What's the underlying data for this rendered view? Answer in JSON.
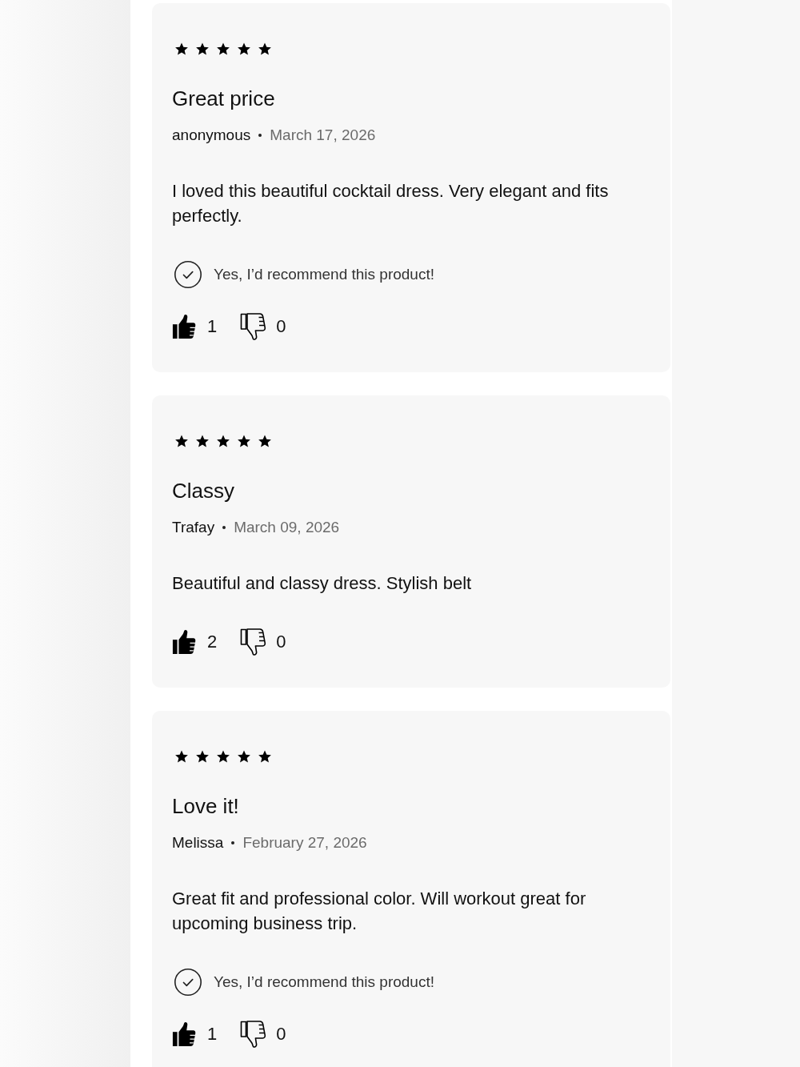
{
  "reviews": [
    {
      "stars": 5,
      "title": "Great price",
      "author": "anonymous",
      "date": "March 17, 2026",
      "body": "I loved this beautiful cocktail dress. Very elegant and fits perfectly.",
      "recommendation": "Yes, I’d recommend this product!",
      "helpful_count": "1",
      "unhelpful_count": "0"
    },
    {
      "stars": 5,
      "title": "Classy",
      "author": "Trafay",
      "date": "March 09, 2026",
      "body": "Beautiful and classy dress. Stylish belt",
      "helpful_count": "2",
      "unhelpful_count": "0"
    },
    {
      "stars": 5,
      "title": "Love it!",
      "author": "Melissa",
      "date": "February 27, 2026",
      "body": "Great fit and professional color. Will workout great for upcoming business trip.",
      "recommendation": "Yes, I’d recommend this product!",
      "helpful_count": "1",
      "unhelpful_count": "0"
    }
  ]
}
